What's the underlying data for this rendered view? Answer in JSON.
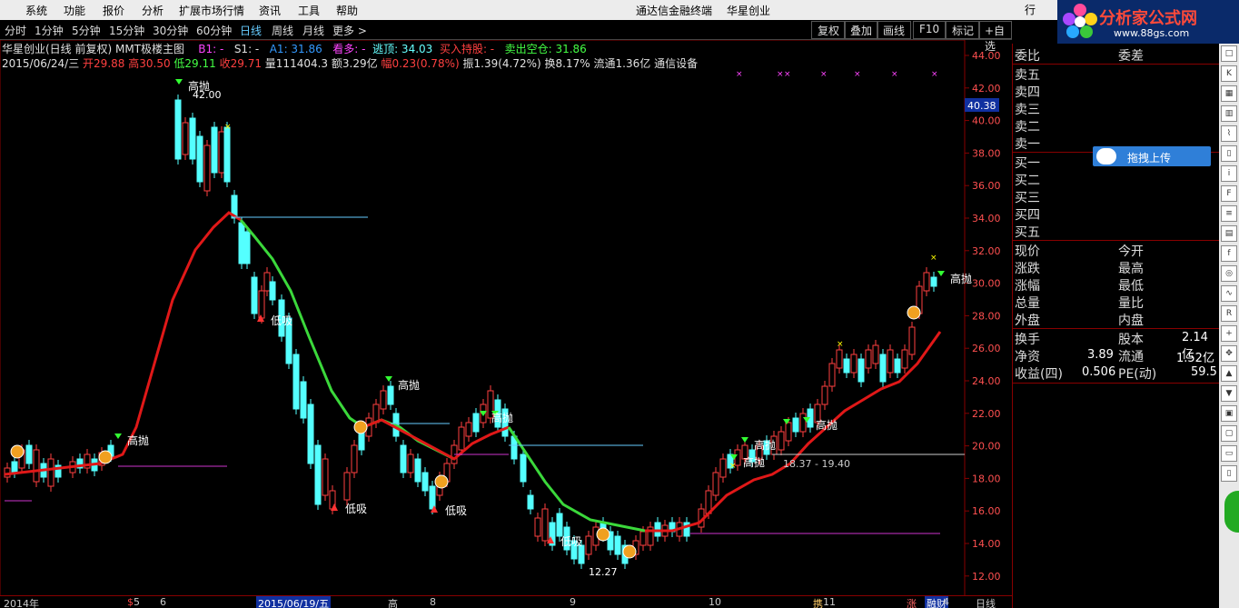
{
  "menubar": {
    "items": [
      "系统",
      "功能",
      "报价",
      "分析",
      "扩展市场行情",
      "资讯",
      "工具",
      "帮助"
    ],
    "app_title": "通达信金融终端",
    "stock_name": "华星创业",
    "extra": "行"
  },
  "logo": {
    "text": "分析家公式网",
    "url": "www.88gs.com"
  },
  "periods": [
    "分时",
    "1分钟",
    "5分钟",
    "15分钟",
    "30分钟",
    "60分钟",
    "日线",
    "周线",
    "月线",
    "更多 >"
  ],
  "active_period": "日线",
  "tools": [
    "复权",
    "叠加",
    "画线",
    "F10",
    "标记",
    "+自选"
  ],
  "info": {
    "title": "华星创业(日线 前复权) MMT极楼主图",
    "b1": "B1: -",
    "s1": "S1: -",
    "a1": "A1: 31.86",
    "kanduo": "看多: -",
    "taoding": "逃顶: 34.03",
    "mairu": "买入持股: -",
    "maichu": "卖出空仓: 31.86",
    "date": "2015/06/24/三",
    "open": "开29.88",
    "high": "高30.50",
    "low": "低29.11",
    "close": "收29.71",
    "vol": "量111404.3",
    "amount": "额3.29亿",
    "change": "幅0.23(0.78%)",
    "amp": "振1.39(4.72%)",
    "turnover": "换8.17%",
    "float": "流通1.36亿",
    "industry": "通信设备"
  },
  "price_axis": {
    "labels": [
      "44.00",
      "42.00",
      "40.00",
      "38.00",
      "36.00",
      "34.00",
      "32.00",
      "30.00",
      "28.00",
      "26.00",
      "24.00",
      "22.00",
      "20.00",
      "18.00",
      "16.00",
      "14.00",
      "12.00"
    ],
    "current": "40.38"
  },
  "annotations": {
    "gaopao": "高抛",
    "dixi": "低吸",
    "high_price": "42.00",
    "low_price": "12.27",
    "range": "18.37 - 19.40"
  },
  "date_axis": {
    "ticks": [
      "2014年",
      "5",
      "6",
      "2015/06/19/五",
      "高",
      "8",
      "9",
      "10",
      "11",
      "4"
    ],
    "markers": [
      "$",
      "携",
      "涨",
      "融财"
    ],
    "selected": "2015/06/19/五",
    "right_label": "日线"
  },
  "quote": {
    "weibi": "委比",
    "weicha": "委差",
    "asks": [
      "卖五",
      "卖四",
      "卖三",
      "卖二",
      "卖一"
    ],
    "bids": [
      "买一",
      "买二",
      "买三",
      "买四",
      "买五"
    ],
    "upload": "拖拽上传",
    "r1": [
      "现价",
      "今开"
    ],
    "r2": [
      "涨跌",
      "最高"
    ],
    "r3": [
      "涨幅",
      "最低"
    ],
    "r4": [
      "总量",
      "量比"
    ],
    "r5": [
      "外盘",
      "内盘"
    ],
    "huanshou": "换手",
    "guben": "股本",
    "guben_val": "2.14亿",
    "jingzi": "净资",
    "jingzi_val": "3.89",
    "liutong": "流通",
    "liutong_val": "1.52亿",
    "shouyi": "收益(四)",
    "shouyi_val": "0.506",
    "pe": "PE(动)",
    "pe_val": "59.5"
  },
  "colors": {
    "up": "#ff4040",
    "down": "#54ffff",
    "ma_red": "#e01818",
    "ma_green": "#3bd83b"
  }
}
